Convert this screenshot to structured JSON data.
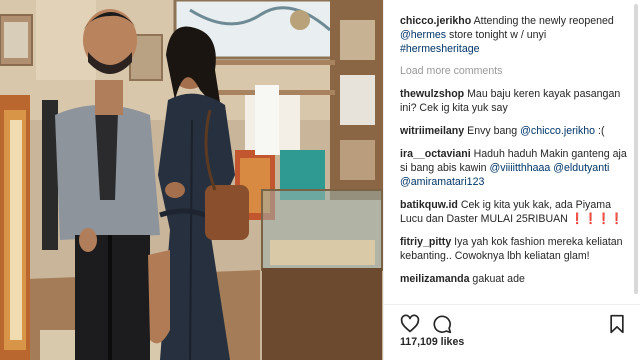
{
  "post": {
    "author": "chicco.jerikho",
    "caption_parts": [
      {
        "t": "text",
        "v": " Attending the newly reopened "
      },
      {
        "t": "mention",
        "v": "@hermes"
      },
      {
        "t": "text",
        "v": " store tonight w / unyi "
      },
      {
        "t": "hashtag",
        "v": "#hermesheritage"
      }
    ],
    "load_more": "Load more comments",
    "likes_count": "117,109",
    "likes_suffix": "likes"
  },
  "comments": [
    {
      "user": "thewulzshop",
      "parts": [
        {
          "t": "text",
          "v": " Mau baju keren kayak pasangan ini? Cek ig kita yuk say"
        }
      ]
    },
    {
      "user": "witriimeilany",
      "parts": [
        {
          "t": "text",
          "v": " Envy bang "
        },
        {
          "t": "mention",
          "v": "@chicco.jerikho"
        },
        {
          "t": "text",
          "v": " :("
        }
      ]
    },
    {
      "user": "ira__octaviani",
      "parts": [
        {
          "t": "text",
          "v": " Haduh haduh Makin ganteng aja si bang abis kawin "
        },
        {
          "t": "mention",
          "v": "@viiiitthhaaa"
        },
        {
          "t": "text",
          "v": " "
        },
        {
          "t": "mention",
          "v": "@eldutyanti"
        },
        {
          "t": "text",
          "v": " "
        },
        {
          "t": "mention",
          "v": "@amiramatari123"
        }
      ]
    },
    {
      "user": "batikquw.id",
      "parts": [
        {
          "t": "text",
          "v": " Cek ig kita yuk kak, ada Piyama Lucu dan Daster MULAI 25RIBUAN ❗❗❗❗"
        }
      ]
    },
    {
      "user": "fitriy_pitty",
      "parts": [
        {
          "t": "text",
          "v": " Iya yah kok fashion mereka keliatan kebanting.. Cowoknya lbh keliatan glam!"
        }
      ]
    },
    {
      "user": "meilizamanda",
      "parts": [
        {
          "t": "text",
          "v": " gakuat ade"
        }
      ]
    }
  ],
  "icons": {
    "like": "heart-icon",
    "comment": "speech-bubble-icon",
    "save": "bookmark-icon"
  },
  "colors": {
    "link": "#003569",
    "muted": "#999999",
    "text": "#262626"
  }
}
